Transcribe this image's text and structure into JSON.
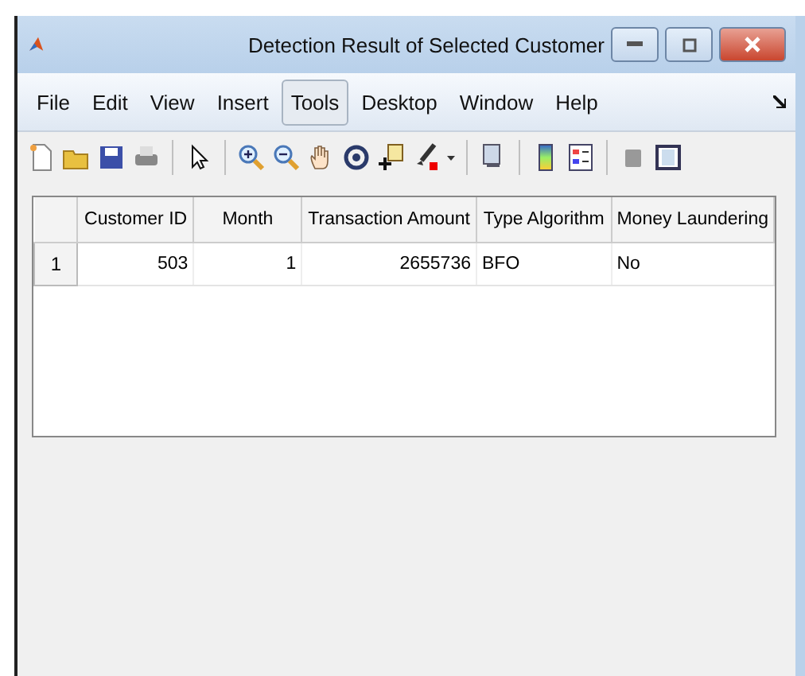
{
  "window": {
    "title": "Detection Result of Selected Customer"
  },
  "menu": [
    {
      "label": "File",
      "selected": false
    },
    {
      "label": "Edit",
      "selected": false
    },
    {
      "label": "View",
      "selected": false
    },
    {
      "label": "Insert",
      "selected": false
    },
    {
      "label": "Tools",
      "selected": true
    },
    {
      "label": "Desktop",
      "selected": false
    },
    {
      "label": "Window",
      "selected": false
    },
    {
      "label": "Help",
      "selected": false
    }
  ],
  "table": {
    "columns": [
      "Customer ID",
      "Month",
      "Transaction Amount",
      "Type Algorithm",
      "Money Laundering"
    ],
    "rows": [
      {
        "header": "1",
        "cells": [
          "503",
          "1",
          "2655736",
          "BFO",
          "No"
        ]
      }
    ]
  }
}
